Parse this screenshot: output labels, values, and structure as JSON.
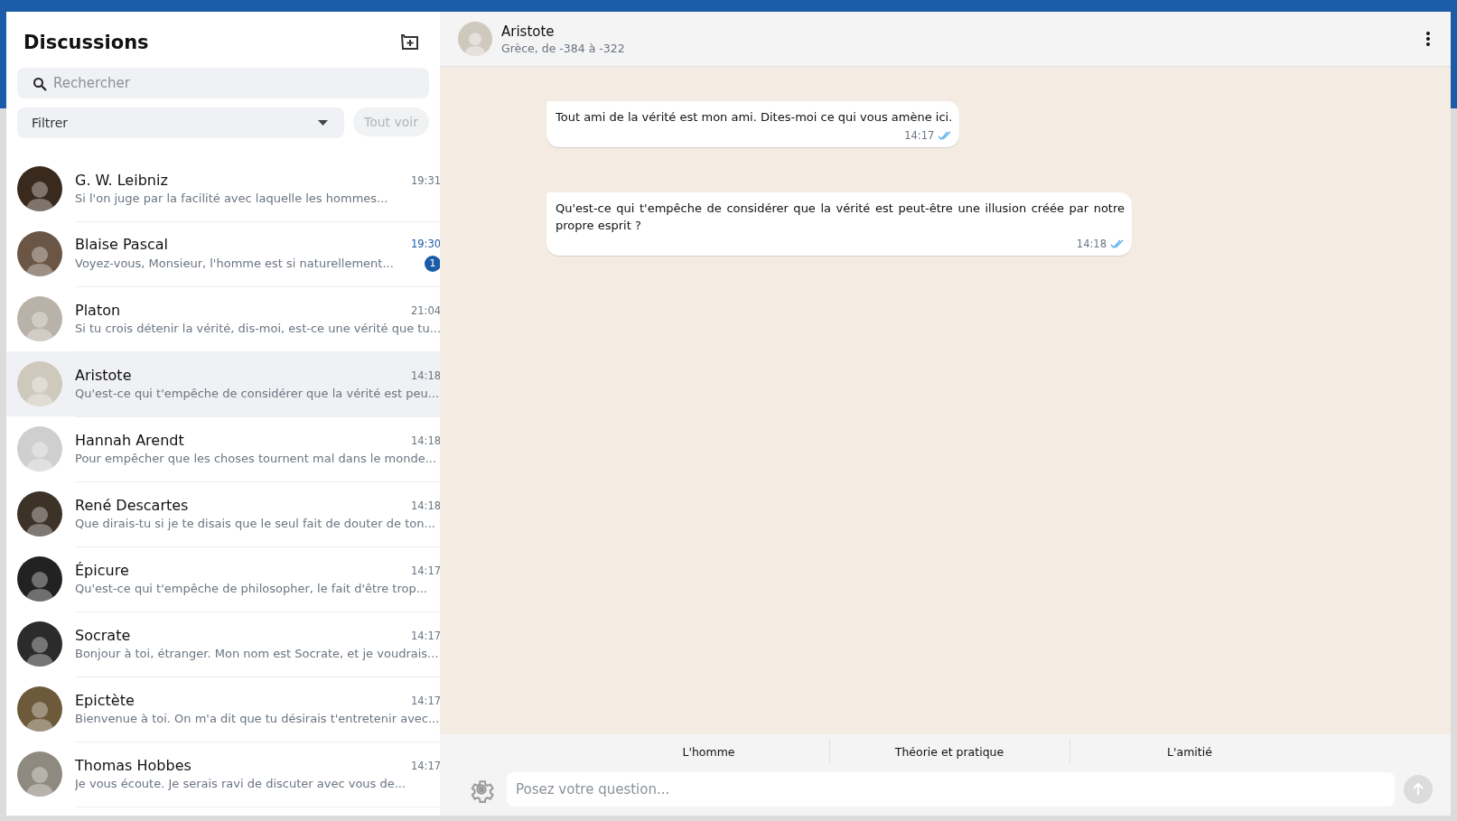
{
  "sidebar": {
    "title": "Discussions",
    "search": {
      "placeholder": "Rechercher"
    },
    "filter": {
      "value": "Filtrer"
    },
    "show_all": {
      "label": "Tout voir",
      "disabled": true
    },
    "conversations": [
      {
        "name": "G. W. Leibniz",
        "time": "19:31",
        "preview": "Si l'on juge par la facilité avec laquelle les hommes...",
        "selected": false
      },
      {
        "name": "Blaise Pascal",
        "time": "19:30",
        "preview": "Voyez-vous, Monsieur, l'homme est si naturellement...",
        "unread": "1",
        "selected": false
      },
      {
        "name": "Platon",
        "time": "21:04",
        "preview": "Si tu crois détenir la vérité, dis-moi, est-ce une vérité que tu...",
        "selected": false
      },
      {
        "name": "Aristote",
        "time": "14:18",
        "preview": "Qu'est-ce qui t'empêche de considérer que la vérité est peu...",
        "selected": true
      },
      {
        "name": "Hannah Arendt",
        "time": "14:18",
        "preview": "Pour empêcher que les choses tournent mal dans le monde...",
        "selected": false
      },
      {
        "name": "René Descartes",
        "time": "14:18",
        "preview": "Que dirais-tu si je te disais que le seul fait de douter de ton...",
        "selected": false
      },
      {
        "name": "Épicure",
        "time": "14:17",
        "preview": "Qu'est-ce qui t'empêche de philosopher, le fait d'être trop...",
        "selected": false
      },
      {
        "name": "Socrate",
        "time": "14:17",
        "preview": "Bonjour à toi, étranger. Mon nom est Socrate, et je voudrais...",
        "selected": false
      },
      {
        "name": "Epictète",
        "time": "14:17",
        "preview": "Bienvenue à toi. On m'a dit que tu désirais t'entretenir avec...",
        "selected": false
      },
      {
        "name": "Thomas Hobbes",
        "time": "14:17",
        "preview": "Je vous écoute. Je serais ravi de discuter avec vous de...",
        "selected": false
      }
    ]
  },
  "chat": {
    "name": "Aristote",
    "subtitle": "Grèce, de -384 à -322",
    "messages": [
      {
        "text": "Tout ami de la vérité est mon ami. Dites-moi ce qui vous amène ici.",
        "time": "14:17",
        "read": true
      },
      {
        "text": "Qu'est-ce qui t'empêche de considérer que la vérité est peut-être une illusion créée par notre propre esprit ?",
        "time": "14:18",
        "read": true
      }
    ],
    "suggestions": [
      "L'homme",
      "Théorie et pratique",
      "L'amitié"
    ],
    "input": {
      "placeholder": "Posez votre question...",
      "send_disabled": true
    }
  }
}
